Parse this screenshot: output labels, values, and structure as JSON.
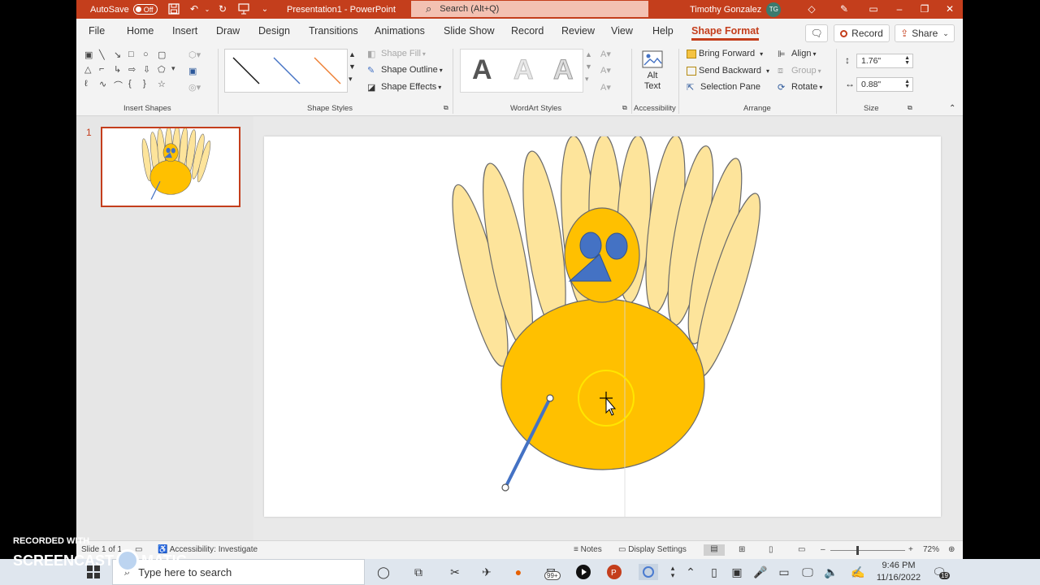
{
  "titlebar": {
    "autosave_label": "AutoSave",
    "autosave_state": "Off",
    "doc_title": "Presentation1  -  PowerPoint",
    "search_placeholder": "Search (Alt+Q)",
    "user_name": "Timothy Gonzalez",
    "user_initials": "TG"
  },
  "menu": {
    "tabs": [
      "File",
      "Home",
      "Insert",
      "Draw",
      "Design",
      "Transitions",
      "Animations",
      "Slide Show",
      "Record",
      "Review",
      "View",
      "Help",
      "Shape Format"
    ],
    "active_tab": "Shape Format",
    "record_label": "Record",
    "share_label": "Share"
  },
  "ribbon": {
    "groups": {
      "insert_shapes": "Insert Shapes",
      "shape_styles": "Shape Styles",
      "wordart_styles": "WordArt Styles",
      "accessibility": "Accessibility",
      "arrange": "Arrange",
      "size": "Size"
    },
    "shape_fill": "Shape Fill",
    "shape_outline": "Shape Outline",
    "shape_effects": "Shape Effects",
    "alt_text_1": "Alt",
    "alt_text_2": "Text",
    "bring_forward": "Bring Forward",
    "send_backward": "Send Backward",
    "selection_pane": "Selection Pane",
    "align": "Align",
    "group": "Group",
    "rotate": "Rotate",
    "height": "1.76\"",
    "width": "0.88\""
  },
  "thumbnails": {
    "slide_number": "1"
  },
  "status": {
    "slide_info": "Slide 1 of 1",
    "accessibility": "Accessibility: Investigate",
    "notes": "Notes",
    "display_settings": "Display Settings",
    "zoom": "72%"
  },
  "taskbar": {
    "search_placeholder": "Type here to search",
    "mail_badge": "99+",
    "time": "9:46 PM",
    "date": "11/16/2022",
    "notif_count": "19"
  },
  "watermark": {
    "line1": "RECORDED WITH",
    "line2a": "SCREENCAST",
    "line2b": "MATIC"
  },
  "colors": {
    "accent": "#c43e1c",
    "feather": "#fde49b",
    "body": "#ffc000",
    "eye": "#4472c4",
    "leg": "#4472c4"
  }
}
